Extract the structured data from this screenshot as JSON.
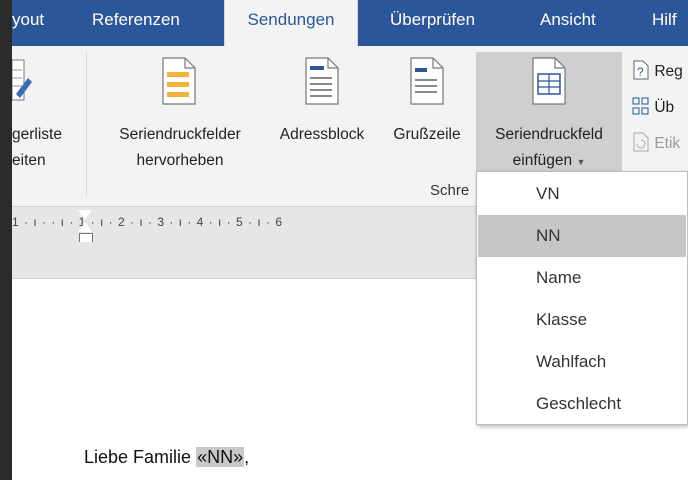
{
  "tabs": [
    {
      "label": "yout"
    },
    {
      "label": "Referenzen"
    },
    {
      "label": "Sendungen",
      "active": true
    },
    {
      "label": "Überprüfen"
    },
    {
      "label": "Ansicht"
    },
    {
      "label": "Hilf"
    }
  ],
  "ribbon": {
    "buttons": [
      {
        "line1": "gerliste",
        "line2": "eiten"
      },
      {
        "line1": "Seriendruckfelder",
        "line2": "hervorheben"
      },
      {
        "line1": "Adressblock",
        "line2": ""
      },
      {
        "line1": "Grußzeile",
        "line2": ""
      },
      {
        "line1": "Seriendruckfeld",
        "line2": "einfügen"
      }
    ],
    "small_buttons": [
      "Reg",
      "Üb",
      "Etik"
    ],
    "group_label": "Schre"
  },
  "ruler": {
    "text": "1 · ı ·     · ı · 1 · ı · 2 · ı · 3 · ı · 4 · ı · 5 · ı · 6",
    "tail": "·"
  },
  "dropdown": {
    "items": [
      "VN",
      "NN",
      "Name",
      "Klasse",
      "Wahlfach",
      "Geschlecht"
    ],
    "selected_index": 1
  },
  "document": {
    "text_before": "Liebe Familie ",
    "field": "«NN»",
    "text_after": ","
  },
  "colors": {
    "tabbar": "#2b579a",
    "ribbon": "#f3f3f3",
    "selection": "#c6c6c6"
  }
}
